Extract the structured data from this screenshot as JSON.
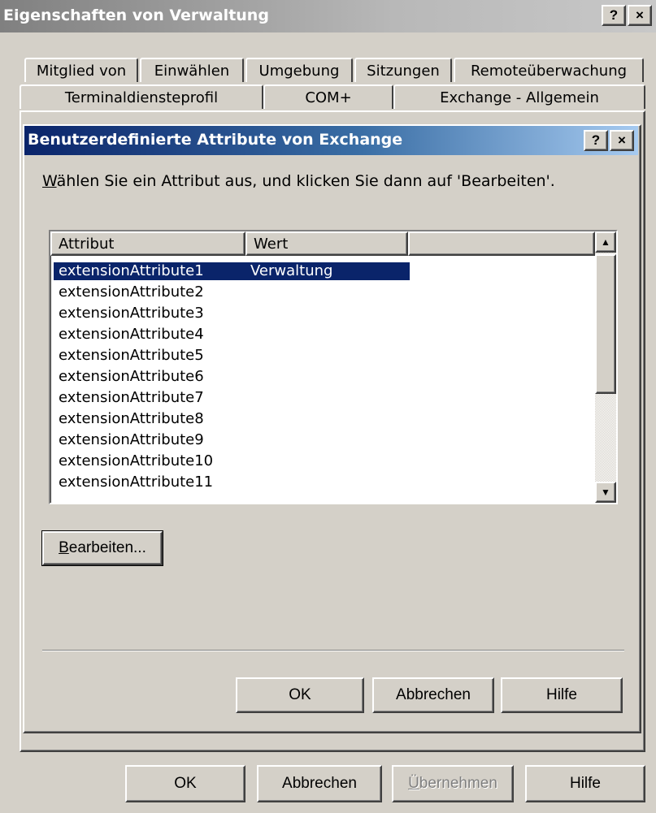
{
  "outer_window": {
    "title": "Eigenschaften von Verwaltung",
    "help_btn": "?",
    "close_btn": "×"
  },
  "tabs": {
    "row1": [
      "Mitglied von",
      "Einwählen",
      "Umgebung",
      "Sitzungen",
      "Remoteüberwachung"
    ],
    "row2": [
      "Terminaldiensteprofil",
      "COM+",
      "Exchange - Allgemein"
    ]
  },
  "dialog": {
    "title": "Benutzerdefinierte Attribute von Exchange",
    "help_btn": "?",
    "close_btn": "×",
    "instruction_prefix": "W",
    "instruction_rest": "ählen Sie ein Attribut aus, und klicken Sie dann auf 'Bearbeiten'.",
    "list": {
      "columns": [
        "Attribut",
        "Wert"
      ],
      "rows": [
        {
          "attribute": "extensionAttribute1",
          "value": "Verwaltung",
          "selected": true
        },
        {
          "attribute": "extensionAttribute2",
          "value": ""
        },
        {
          "attribute": "extensionAttribute3",
          "value": ""
        },
        {
          "attribute": "extensionAttribute4",
          "value": ""
        },
        {
          "attribute": "extensionAttribute5",
          "value": ""
        },
        {
          "attribute": "extensionAttribute6",
          "value": ""
        },
        {
          "attribute": "extensionAttribute7",
          "value": ""
        },
        {
          "attribute": "extensionAttribute8",
          "value": ""
        },
        {
          "attribute": "extensionAttribute9",
          "value": ""
        },
        {
          "attribute": "extensionAttribute10",
          "value": ""
        },
        {
          "attribute": "extensionAttribute11",
          "value": ""
        }
      ]
    },
    "edit_btn_prefix": "B",
    "edit_btn_rest": "earbeiten...",
    "ok": "OK",
    "cancel": "Abbrechen",
    "help": "Hilfe"
  },
  "outer_buttons": {
    "ok": "OK",
    "cancel": "Abbrechen",
    "apply_prefix": "Ü",
    "apply_rest": "bernehmen",
    "help": "Hilfe"
  },
  "icons": {
    "scroll_up": "▲",
    "scroll_down": "▼"
  }
}
